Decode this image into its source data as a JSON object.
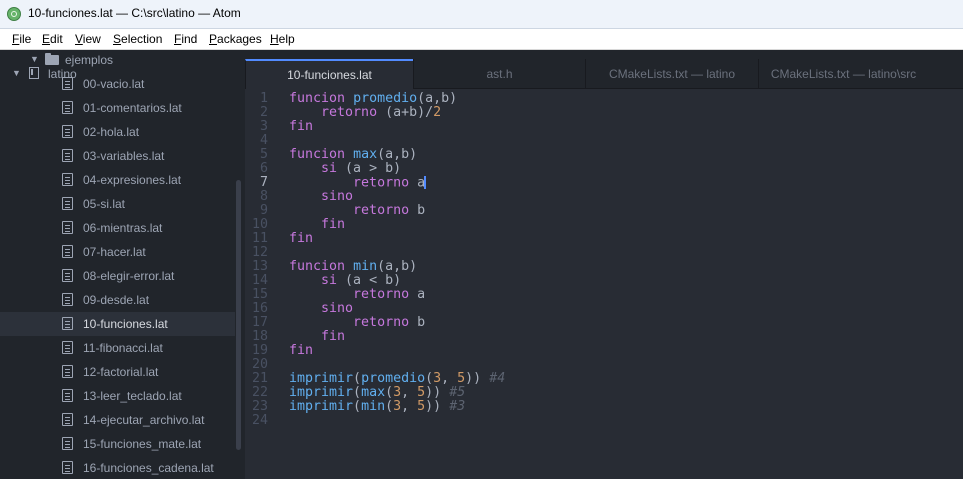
{
  "window": {
    "title": "10-funciones.lat — C:\\src\\latino — Atom"
  },
  "menu": [
    {
      "label": "File",
      "accel": "F",
      "rest": "ile"
    },
    {
      "label": "Edit",
      "accel": "E",
      "rest": "dit"
    },
    {
      "label": "View",
      "accel": "V",
      "rest": "iew"
    },
    {
      "label": "Selection",
      "accel": "S",
      "rest": "election"
    },
    {
      "label": "Find",
      "accel": "F",
      "rest": "ind"
    },
    {
      "label": "Packages",
      "accel": "P",
      "rest": "ackages"
    },
    {
      "label": "Help",
      "accel": "H",
      "rest": "elp"
    }
  ],
  "tree": {
    "folder_ejemplos": "ejemplos",
    "root": "latino",
    "files": [
      "00-vacio.lat",
      "01-comentarios.lat",
      "02-hola.lat",
      "03-variables.lat",
      "04-expresiones.lat",
      "05-si.lat",
      "06-mientras.lat",
      "07-hacer.lat",
      "08-elegir-error.lat",
      "09-desde.lat",
      "10-funciones.lat",
      "11-fibonacci.lat",
      "12-factorial.lat",
      "13-leer_teclado.lat",
      "14-ejecutar_archivo.lat",
      "15-funciones_mate.lat",
      "16-funciones_cadena.lat"
    ],
    "selected_index": 10
  },
  "tabs": [
    {
      "label": "10-funciones.lat",
      "active": true
    },
    {
      "label": "ast.h",
      "active": false
    },
    {
      "label": "CMakeLists.txt — latino",
      "active": false
    },
    {
      "label": "CMakeLists.txt — latino\\src",
      "active": false
    }
  ],
  "editor": {
    "current_line": 7,
    "lines": [
      [
        [
          "kw",
          "funcion"
        ],
        [
          "t",
          " "
        ],
        [
          "fn",
          "promedio"
        ],
        [
          "t",
          "(a,b)"
        ]
      ],
      [
        [
          "t",
          "    "
        ],
        [
          "kw",
          "retorno"
        ],
        [
          "t",
          " (a+b)/"
        ],
        [
          "num",
          "2"
        ]
      ],
      [
        [
          "kw",
          "fin"
        ]
      ],
      [],
      [
        [
          "kw",
          "funcion"
        ],
        [
          "t",
          " "
        ],
        [
          "fn",
          "max"
        ],
        [
          "t",
          "(a,b)"
        ]
      ],
      [
        [
          "t",
          "    "
        ],
        [
          "kw",
          "si"
        ],
        [
          "t",
          " (a > b)"
        ]
      ],
      [
        [
          "t",
          "        "
        ],
        [
          "kw",
          "retorno"
        ],
        [
          "t",
          " a"
        ],
        [
          "cursor",
          ""
        ]
      ],
      [
        [
          "t",
          "    "
        ],
        [
          "kw",
          "sino"
        ]
      ],
      [
        [
          "t",
          "        "
        ],
        [
          "kw",
          "retorno"
        ],
        [
          "t",
          " b"
        ]
      ],
      [
        [
          "t",
          "    "
        ],
        [
          "kw",
          "fin"
        ]
      ],
      [
        [
          "kw",
          "fin"
        ]
      ],
      [],
      [
        [
          "kw",
          "funcion"
        ],
        [
          "t",
          " "
        ],
        [
          "fn",
          "min"
        ],
        [
          "t",
          "(a,b)"
        ]
      ],
      [
        [
          "t",
          "    "
        ],
        [
          "kw",
          "si"
        ],
        [
          "t",
          " (a < b)"
        ]
      ],
      [
        [
          "t",
          "        "
        ],
        [
          "kw",
          "retorno"
        ],
        [
          "t",
          " a"
        ]
      ],
      [
        [
          "t",
          "    "
        ],
        [
          "kw",
          "sino"
        ]
      ],
      [
        [
          "t",
          "        "
        ],
        [
          "kw",
          "retorno"
        ],
        [
          "t",
          " b"
        ]
      ],
      [
        [
          "t",
          "    "
        ],
        [
          "kw",
          "fin"
        ]
      ],
      [
        [
          "kw",
          "fin"
        ]
      ],
      [],
      [
        [
          "fn",
          "imprimir"
        ],
        [
          "t",
          "("
        ],
        [
          "fn",
          "promedio"
        ],
        [
          "t",
          "("
        ],
        [
          "num",
          "3"
        ],
        [
          "t",
          ", "
        ],
        [
          "num",
          "5"
        ],
        [
          "t",
          "))"
        ],
        [
          "t",
          " "
        ],
        [
          "cm",
          "#4"
        ]
      ],
      [
        [
          "fn",
          "imprimir"
        ],
        [
          "t",
          "("
        ],
        [
          "fn",
          "max"
        ],
        [
          "t",
          "("
        ],
        [
          "num",
          "3"
        ],
        [
          "t",
          ", "
        ],
        [
          "num",
          "5"
        ],
        [
          "t",
          "))"
        ],
        [
          "t",
          " "
        ],
        [
          "cm",
          "#5"
        ]
      ],
      [
        [
          "fn",
          "imprimir"
        ],
        [
          "t",
          "("
        ],
        [
          "fn",
          "min"
        ],
        [
          "t",
          "("
        ],
        [
          "num",
          "3"
        ],
        [
          "t",
          ", "
        ],
        [
          "num",
          "5"
        ],
        [
          "t",
          "))"
        ],
        [
          "t",
          " "
        ],
        [
          "cm",
          "#3"
        ]
      ],
      []
    ]
  }
}
